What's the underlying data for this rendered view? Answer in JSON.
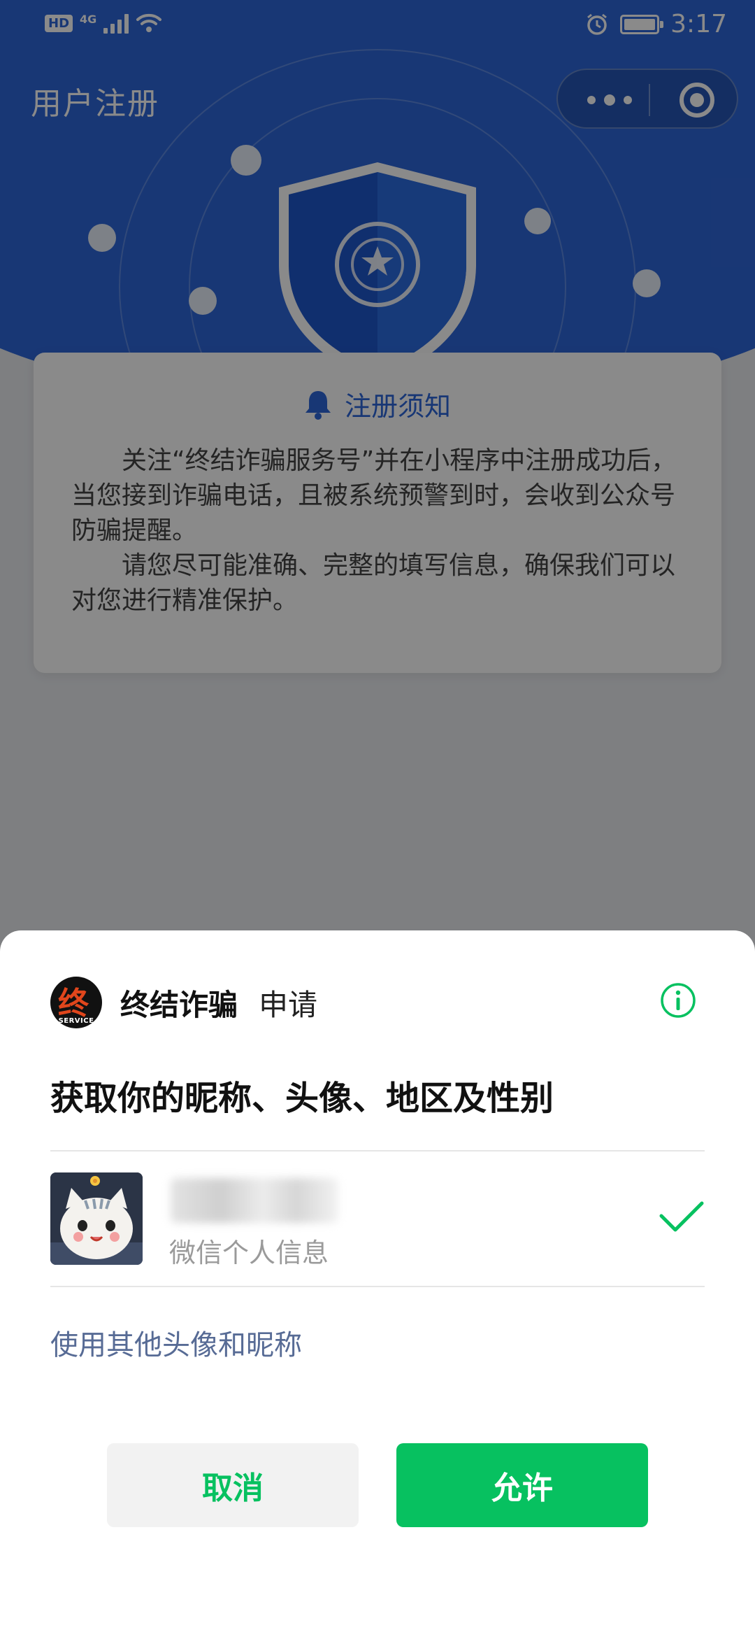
{
  "status_bar": {
    "left_badge": "HD",
    "network": "4G",
    "time": "3:17"
  },
  "nav": {
    "title": "用户注册"
  },
  "notice": {
    "title": "注册须知",
    "paragraphs": [
      "关注“终结诈骗服务号”并在小程序中注册成功后，当您接到诈骗电话，且被系统预警到时，会收到公众号防骗提醒。",
      "请您尽可能准确、完整的填写信息，确保我们可以对您进行精准保护。"
    ]
  },
  "sheet": {
    "app_logo_glyph": "终",
    "app_logo_sub": "SERVICE",
    "app_name": "终结诈骗",
    "request_label": "申请",
    "permission_title": "获取你的昵称、头像、地区及性别",
    "account_label": "微信个人信息",
    "other_link": "使用其他头像和昵称",
    "cancel_label": "取消",
    "allow_label": "允许"
  },
  "colors": {
    "brand_blue": "#2e66d8",
    "wechat_green": "#07c160",
    "link_blue": "#576b95"
  },
  "icons": [
    "wifi-icon",
    "alarm-icon",
    "battery-icon",
    "more-dots-icon",
    "close-target-icon",
    "shield-emblem-icon",
    "bell-icon",
    "info-icon",
    "check-icon"
  ]
}
